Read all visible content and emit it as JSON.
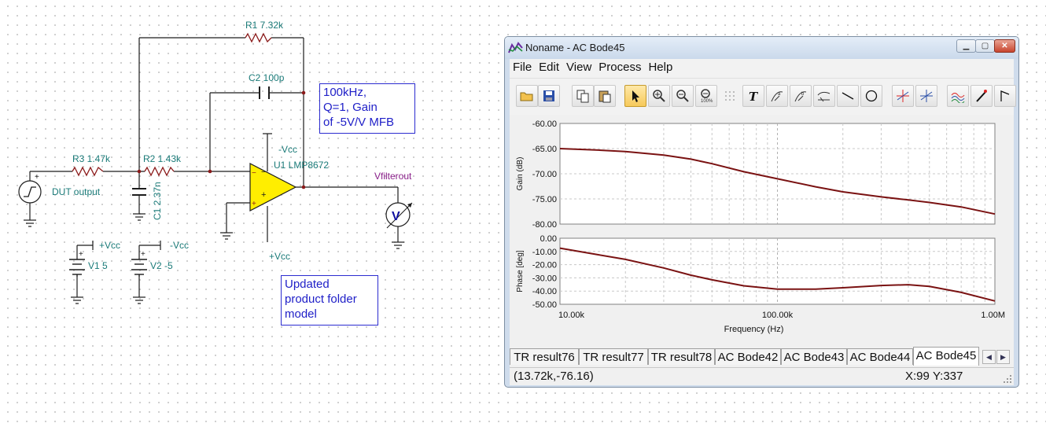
{
  "schematic": {
    "r1": "R1 7.32k",
    "c2": "C2 100p",
    "r3": "R3 1.47k",
    "r2": "R2 1.43k",
    "c1": "C1 2.37n",
    "source": "DUT output",
    "vcc_neg_top": "-Vcc",
    "opamp": "U1 LMP8672",
    "vcc_pos_bottom": "+Vcc",
    "output_net": "Vfilterout",
    "meter_symbol": "V",
    "v1_net": "+Vcc",
    "v1_label": "V1 5",
    "v2_net": "-Vcc",
    "v2_label": "V2 -5",
    "note1": [
      "100kHz,",
      "Q=1, Gain",
      "of -5V/V MFB"
    ],
    "note2": [
      "Updated",
      "product folder",
      "model"
    ]
  },
  "window": {
    "title": "Noname - AC Bode45",
    "menu": [
      "File",
      "Edit",
      "View",
      "Process",
      "Help"
    ],
    "toolbar": [
      "open-icon",
      "save-icon",
      "copy-icon",
      "paste-icon",
      "pointer-icon",
      "zoom-in-icon",
      "zoom-out-icon",
      "zoom-100-icon",
      "grid-icon",
      "text-icon",
      "cursor-a-icon",
      "cursor-b-icon",
      "curve-icon",
      "line-icon",
      "circle-icon",
      "marker-a-icon",
      "marker-b-icon",
      "waveform-icon",
      "probe-icon",
      "flag-icon"
    ],
    "tabs": [
      "TR result76",
      "TR result77",
      "TR result78",
      "AC Bode42",
      "AC Bode43",
      "AC Bode44",
      "AC Bode45"
    ],
    "selected_tab": "AC Bode45",
    "status_coords": "(13.72k,-76.16)",
    "status_x": "X:99",
    "status_y": "Y:337"
  },
  "chart_data": [
    {
      "type": "line",
      "ylabel": "Gain (dB)",
      "xscale": "log",
      "xlim": [
        10000,
        1000000
      ],
      "ylim": [
        -80,
        -60
      ],
      "yticks": [
        "-60.00",
        "-65.00",
        "-70.00",
        "-75.00",
        "-80.00"
      ],
      "grid": true,
      "line_color": "#7a1212",
      "x": [
        10000,
        15000,
        20000,
        30000,
        40000,
        50000,
        70000,
        100000,
        150000,
        200000,
        300000,
        400000,
        500000,
        700000,
        1000000
      ],
      "y": [
        -65.0,
        -65.3,
        -65.6,
        -66.3,
        -67.1,
        -68.0,
        -69.6,
        -71.0,
        -72.6,
        -73.6,
        -74.6,
        -75.2,
        -75.7,
        -76.6,
        -78.0
      ]
    },
    {
      "type": "line",
      "ylabel": "Phase [deg]",
      "xlabel": "Frequency (Hz)",
      "xscale": "log",
      "xlim": [
        10000,
        1000000
      ],
      "ylim": [
        -50,
        0
      ],
      "yticks": [
        "0.00",
        "-10.00",
        "-20.00",
        "-30.00",
        "-40.00",
        "-50.00"
      ],
      "xticks": [
        "10.00k",
        "100.00k",
        "1.00M"
      ],
      "grid": true,
      "line_color": "#7a1212",
      "x": [
        10000,
        15000,
        20000,
        30000,
        40000,
        50000,
        70000,
        100000,
        150000,
        200000,
        300000,
        400000,
        500000,
        700000,
        1000000
      ],
      "y": [
        -7.5,
        -12.5,
        -16.0,
        -22.5,
        -28.0,
        -31.5,
        -36.0,
        -38.5,
        -38.5,
        -37.5,
        -35.8,
        -35.2,
        -36.5,
        -41.0,
        -47.5
      ]
    }
  ]
}
